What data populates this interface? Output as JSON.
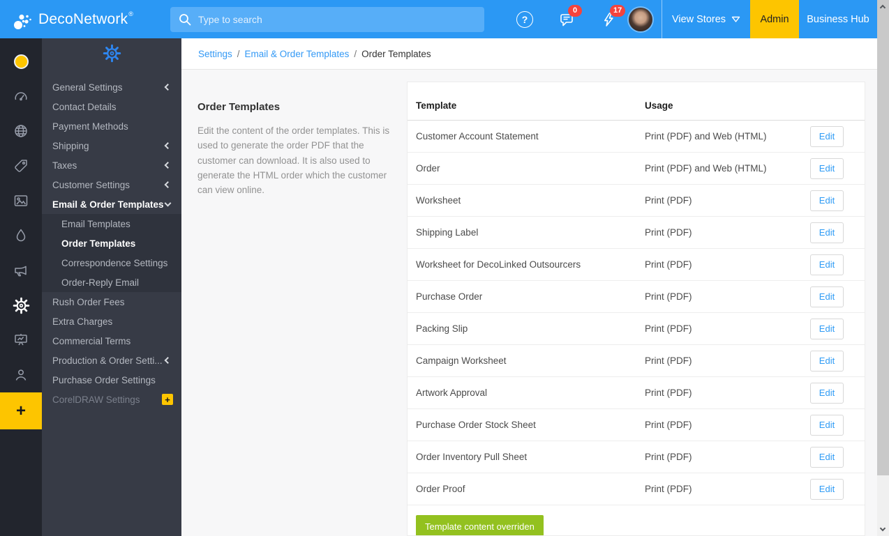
{
  "header": {
    "brand": "DecoNetwork",
    "brand_reg": "®",
    "search": {
      "placeholder": "Type to search"
    },
    "help_glyph": "?",
    "messages_badge": "0",
    "alerts_badge": "17",
    "view_stores_label": "View Stores",
    "admin_label": "Admin",
    "business_hub_label": "Business Hub"
  },
  "rail": {
    "icons": [
      "store-status",
      "dashboard",
      "websites-globe",
      "pricing-tag",
      "media-image",
      "ink-droplet",
      "marketing-megaphone",
      "settings-gear",
      "production-board",
      "customers-user"
    ],
    "active_icon": "settings-gear",
    "add_glyph": "+"
  },
  "sidenav": {
    "plus_badge_glyph": "+",
    "items": [
      {
        "label": "General Settings",
        "chevron": "left"
      },
      {
        "label": "Contact Details"
      },
      {
        "label": "Payment Methods"
      },
      {
        "label": "Shipping",
        "chevron": "left"
      },
      {
        "label": "Taxes",
        "chevron": "left"
      },
      {
        "label": "Customer Settings",
        "chevron": "left"
      },
      {
        "label": "Email & Order Templates",
        "chevron": "down",
        "bold": true
      },
      {
        "label": "Email Templates",
        "sub": true
      },
      {
        "label": "Order Templates",
        "sub": true,
        "active": true
      },
      {
        "label": "Correspondence Settings",
        "sub": true
      },
      {
        "label": "Order-Reply Email",
        "sub": true
      },
      {
        "label": "Rush Order Fees"
      },
      {
        "label": "Extra Charges"
      },
      {
        "label": "Commercial Terms"
      },
      {
        "label": "Production & Order Setti...",
        "chevron": "left"
      },
      {
        "label": "Purchase Order Settings"
      },
      {
        "label": "CorelDRAW Settings",
        "dim": true,
        "plus_badge": true
      }
    ]
  },
  "breadcrumb": {
    "separator": "/",
    "items": [
      {
        "label": "Settings",
        "link": true
      },
      {
        "label": "Email & Order Templates",
        "link": true
      },
      {
        "label": "Order Templates"
      }
    ]
  },
  "panel": {
    "title": "Order Templates",
    "description": "Edit the content of the order templates. This is used to generate the order PDF that the customer can download. It is also used to generate the HTML order which the customer can view online."
  },
  "table": {
    "columns": {
      "template": "Template",
      "usage": "Usage"
    },
    "edit_label": "Edit",
    "rows": [
      {
        "template": "Customer Account Statement",
        "usage": "Print (PDF) and Web (HTML)"
      },
      {
        "template": "Order",
        "usage": "Print (PDF) and Web (HTML)"
      },
      {
        "template": "Worksheet",
        "usage": "Print (PDF)"
      },
      {
        "template": "Shipping Label",
        "usage": "Print (PDF)"
      },
      {
        "template": "Worksheet for DecoLinked Outsourcers",
        "usage": "Print (PDF)"
      },
      {
        "template": "Purchase Order",
        "usage": "Print (PDF)"
      },
      {
        "template": "Packing Slip",
        "usage": "Print (PDF)"
      },
      {
        "template": "Campaign Worksheet",
        "usage": "Print (PDF)"
      },
      {
        "template": "Artwork Approval",
        "usage": "Print (PDF)"
      },
      {
        "template": "Purchase Order Stock Sheet",
        "usage": "Print (PDF)"
      },
      {
        "template": "Order Inventory Pull Sheet",
        "usage": "Print (PDF)"
      },
      {
        "template": "Order Proof",
        "usage": "Print (PDF)"
      }
    ]
  },
  "legend": {
    "label": "Template content overriden"
  },
  "colors": {
    "header_blue": "#2b98f4",
    "accent_yellow": "#fdc500",
    "badge_red": "#f4433c",
    "link_blue": "#3399f5",
    "legend_green": "#93c11f"
  }
}
